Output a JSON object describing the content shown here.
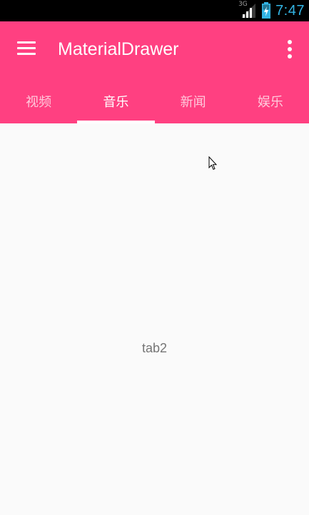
{
  "status_bar": {
    "network_type": "3G",
    "time": "7:47",
    "time_color": "#33b5e5",
    "icons": [
      "signal-icon",
      "battery-charging-icon"
    ]
  },
  "toolbar": {
    "title": "MaterialDrawer",
    "menu_icon": "hamburger-menu-icon",
    "overflow_icon": "more-vert-icon",
    "background_color": "#ff4081"
  },
  "tabs": [
    {
      "label": "视频",
      "active": false
    },
    {
      "label": "音乐",
      "active": true
    },
    {
      "label": "新闻",
      "active": false
    },
    {
      "label": "娱乐",
      "active": false
    }
  ],
  "content": {
    "text": "tab2"
  }
}
